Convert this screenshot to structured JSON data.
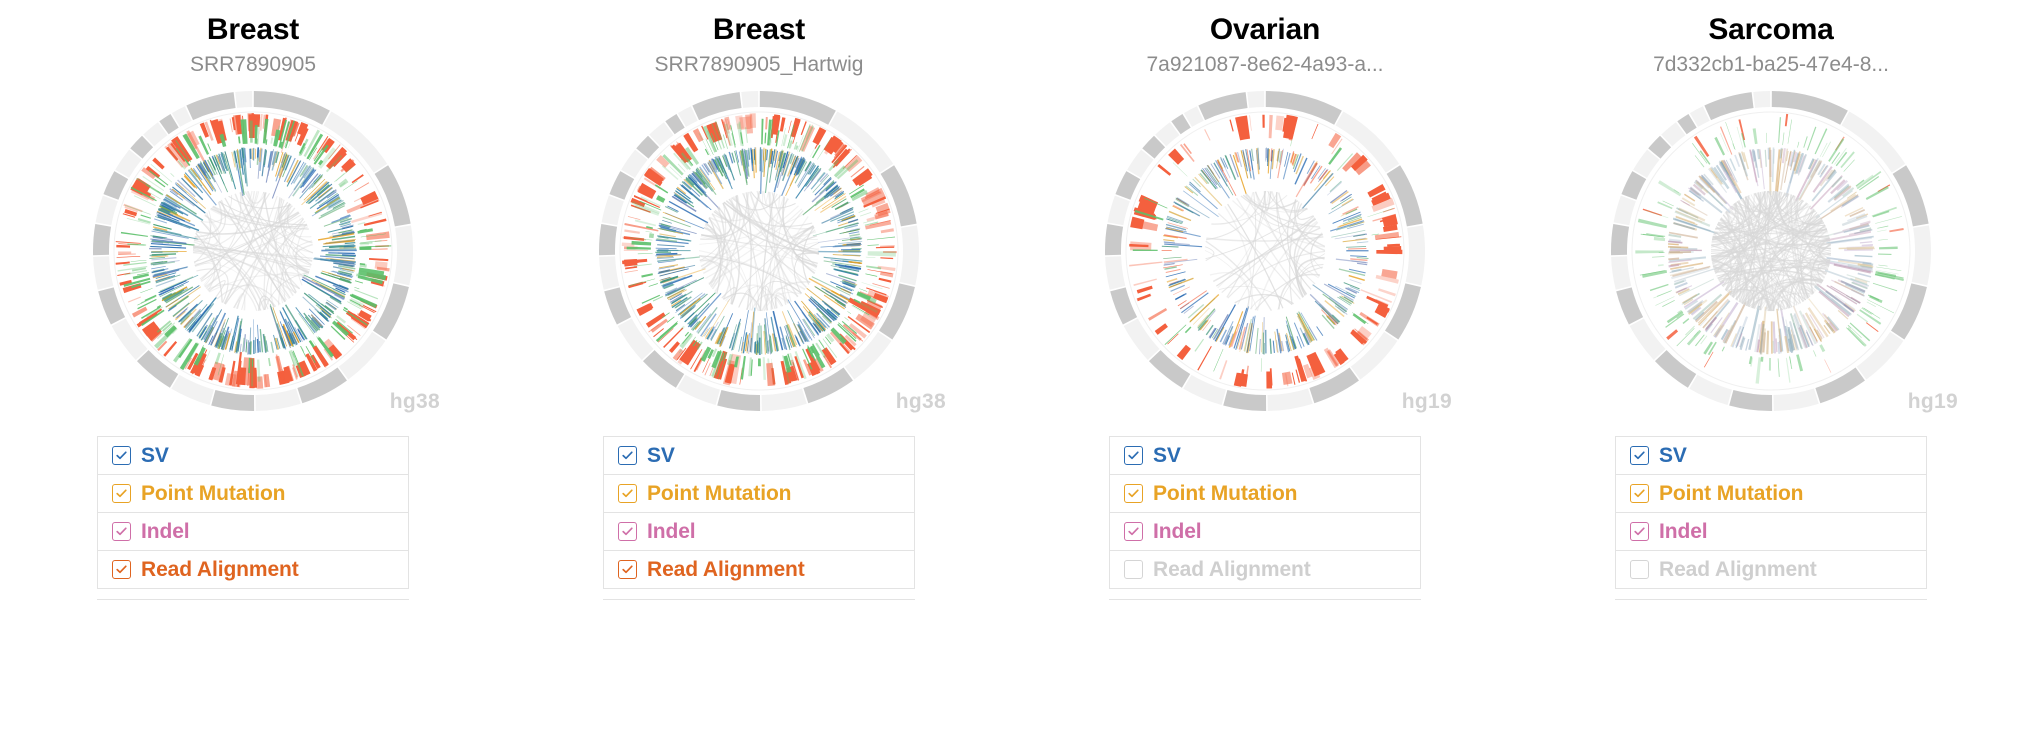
{
  "panels": [
    {
      "title": "Breast",
      "subtitle": "SRR7890905",
      "assembly": "hg38",
      "style": "dense-blue",
      "legend": [
        {
          "label": "SV",
          "color": "#2b6cb3",
          "checked": true,
          "enabled": true
        },
        {
          "label": "Point Mutation",
          "color": "#e8a325",
          "checked": true,
          "enabled": true
        },
        {
          "label": "Indel",
          "color": "#cf6fa8",
          "checked": true,
          "enabled": true
        },
        {
          "label": "Read Alignment",
          "color": "#df6420",
          "checked": true,
          "enabled": true
        }
      ]
    },
    {
      "title": "Breast",
      "subtitle": "SRR7890905_Hartwig",
      "assembly": "hg38",
      "style": "dense-blue",
      "legend": [
        {
          "label": "SV",
          "color": "#2b6cb3",
          "checked": true,
          "enabled": true
        },
        {
          "label": "Point Mutation",
          "color": "#e8a325",
          "checked": true,
          "enabled": true
        },
        {
          "label": "Indel",
          "color": "#cf6fa8",
          "checked": true,
          "enabled": true
        },
        {
          "label": "Read Alignment",
          "color": "#df6420",
          "checked": true,
          "enabled": true
        }
      ]
    },
    {
      "title": "Ovarian",
      "subtitle": "7a921087-8e62-4a93-a...",
      "assembly": "hg19",
      "style": "sparse-red",
      "legend": [
        {
          "label": "SV",
          "color": "#2b6cb3",
          "checked": true,
          "enabled": true
        },
        {
          "label": "Point Mutation",
          "color": "#e8a325",
          "checked": true,
          "enabled": true
        },
        {
          "label": "Indel",
          "color": "#cf6fa8",
          "checked": true,
          "enabled": true
        },
        {
          "label": "Read Alignment",
          "color": "#cfcfcf",
          "checked": false,
          "enabled": false
        }
      ]
    },
    {
      "title": "Sarcoma",
      "subtitle": "7d332cb1-ba25-47e4-8...",
      "assembly": "hg19",
      "style": "pastel-grey",
      "legend": [
        {
          "label": "SV",
          "color": "#2b6cb3",
          "checked": true,
          "enabled": true
        },
        {
          "label": "Point Mutation",
          "color": "#e8a325",
          "checked": true,
          "enabled": true
        },
        {
          "label": "Indel",
          "color": "#cf6fa8",
          "checked": true,
          "enabled": true
        },
        {
          "label": "Read Alignment",
          "color": "#cfcfcf",
          "checked": false,
          "enabled": false
        }
      ]
    }
  ],
  "colors": {
    "cnv_gain": "#f4603e",
    "cnv_loss": "#5cc06a",
    "sv_blue": "#2b6cb3",
    "point_mutation": "#e8a325",
    "indel": "#cf6fa8",
    "read_alignment": "#df6420",
    "chrom_dark": "#c9c9c9",
    "chrom_light": "#f2f2f2",
    "arc_grey": "#d8d8d8",
    "assembly_label": "#d2d2d2",
    "title": "#000000",
    "subtitle": "#8c8c8c",
    "legend_border": "#e3e3e3"
  },
  "icons": {
    "checkmark": "check-icon"
  }
}
